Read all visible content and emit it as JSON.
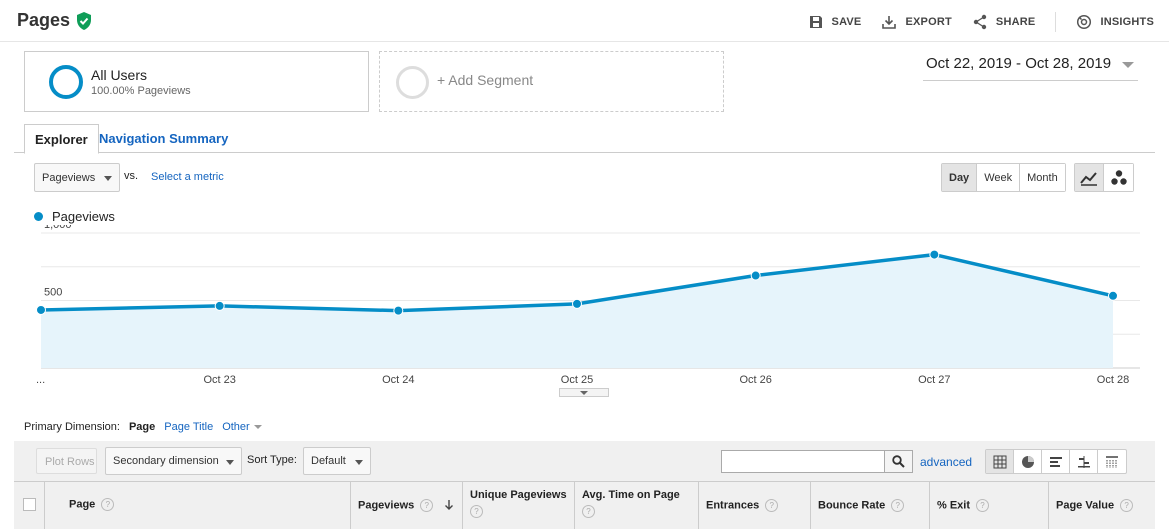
{
  "header": {
    "title": "Pages",
    "actions": {
      "save": "SAVE",
      "export": "EXPORT",
      "share": "SHARE",
      "insights": "INSIGHTS"
    }
  },
  "segments": {
    "active": {
      "name": "All Users",
      "detail": "100.00% Pageviews"
    },
    "add_label": "+ Add Segment"
  },
  "date_range": "Oct 22, 2019 - Oct 28, 2019",
  "tabs": {
    "explorer": "Explorer",
    "navigation_summary": "Navigation Summary"
  },
  "metric_bar": {
    "metric": "Pageviews",
    "vs": "vs.",
    "select_metric": "Select a metric",
    "granularity": [
      "Day",
      "Week",
      "Month"
    ],
    "granularity_selected": "Day"
  },
  "chart_data": {
    "type": "area",
    "series": [
      {
        "name": "Pageviews",
        "values": [
          430,
          460,
          425,
          475,
          685,
          840,
          535
        ],
        "color": "#058dc7"
      }
    ],
    "x": [
      "...",
      "Oct 23",
      "Oct 24",
      "Oct 25",
      "Oct 26",
      "Oct 27",
      "Oct 28"
    ],
    "y_ticks": [
      "1,000",
      "500"
    ],
    "ylim": [
      0,
      1000
    ]
  },
  "primary_dimension": {
    "label": "Primary Dimension:",
    "selected": "Page",
    "page_title": "Page Title",
    "other": "Other"
  },
  "table_toolbar": {
    "plot_rows": "Plot Rows",
    "secondary_dimension": "Secondary dimension",
    "sort_type_label": "Sort Type:",
    "sort_type": "Default",
    "search_value": "",
    "advanced": "advanced"
  },
  "table": {
    "columns": [
      "Page",
      "Pageviews",
      "Unique Pageviews",
      "Avg. Time on Page",
      "Entrances",
      "Bounce Rate",
      "% Exit",
      "Page Value"
    ]
  },
  "colors": {
    "accent": "#058dc7",
    "link": "#1565c0",
    "shield": "#0f9d58"
  }
}
